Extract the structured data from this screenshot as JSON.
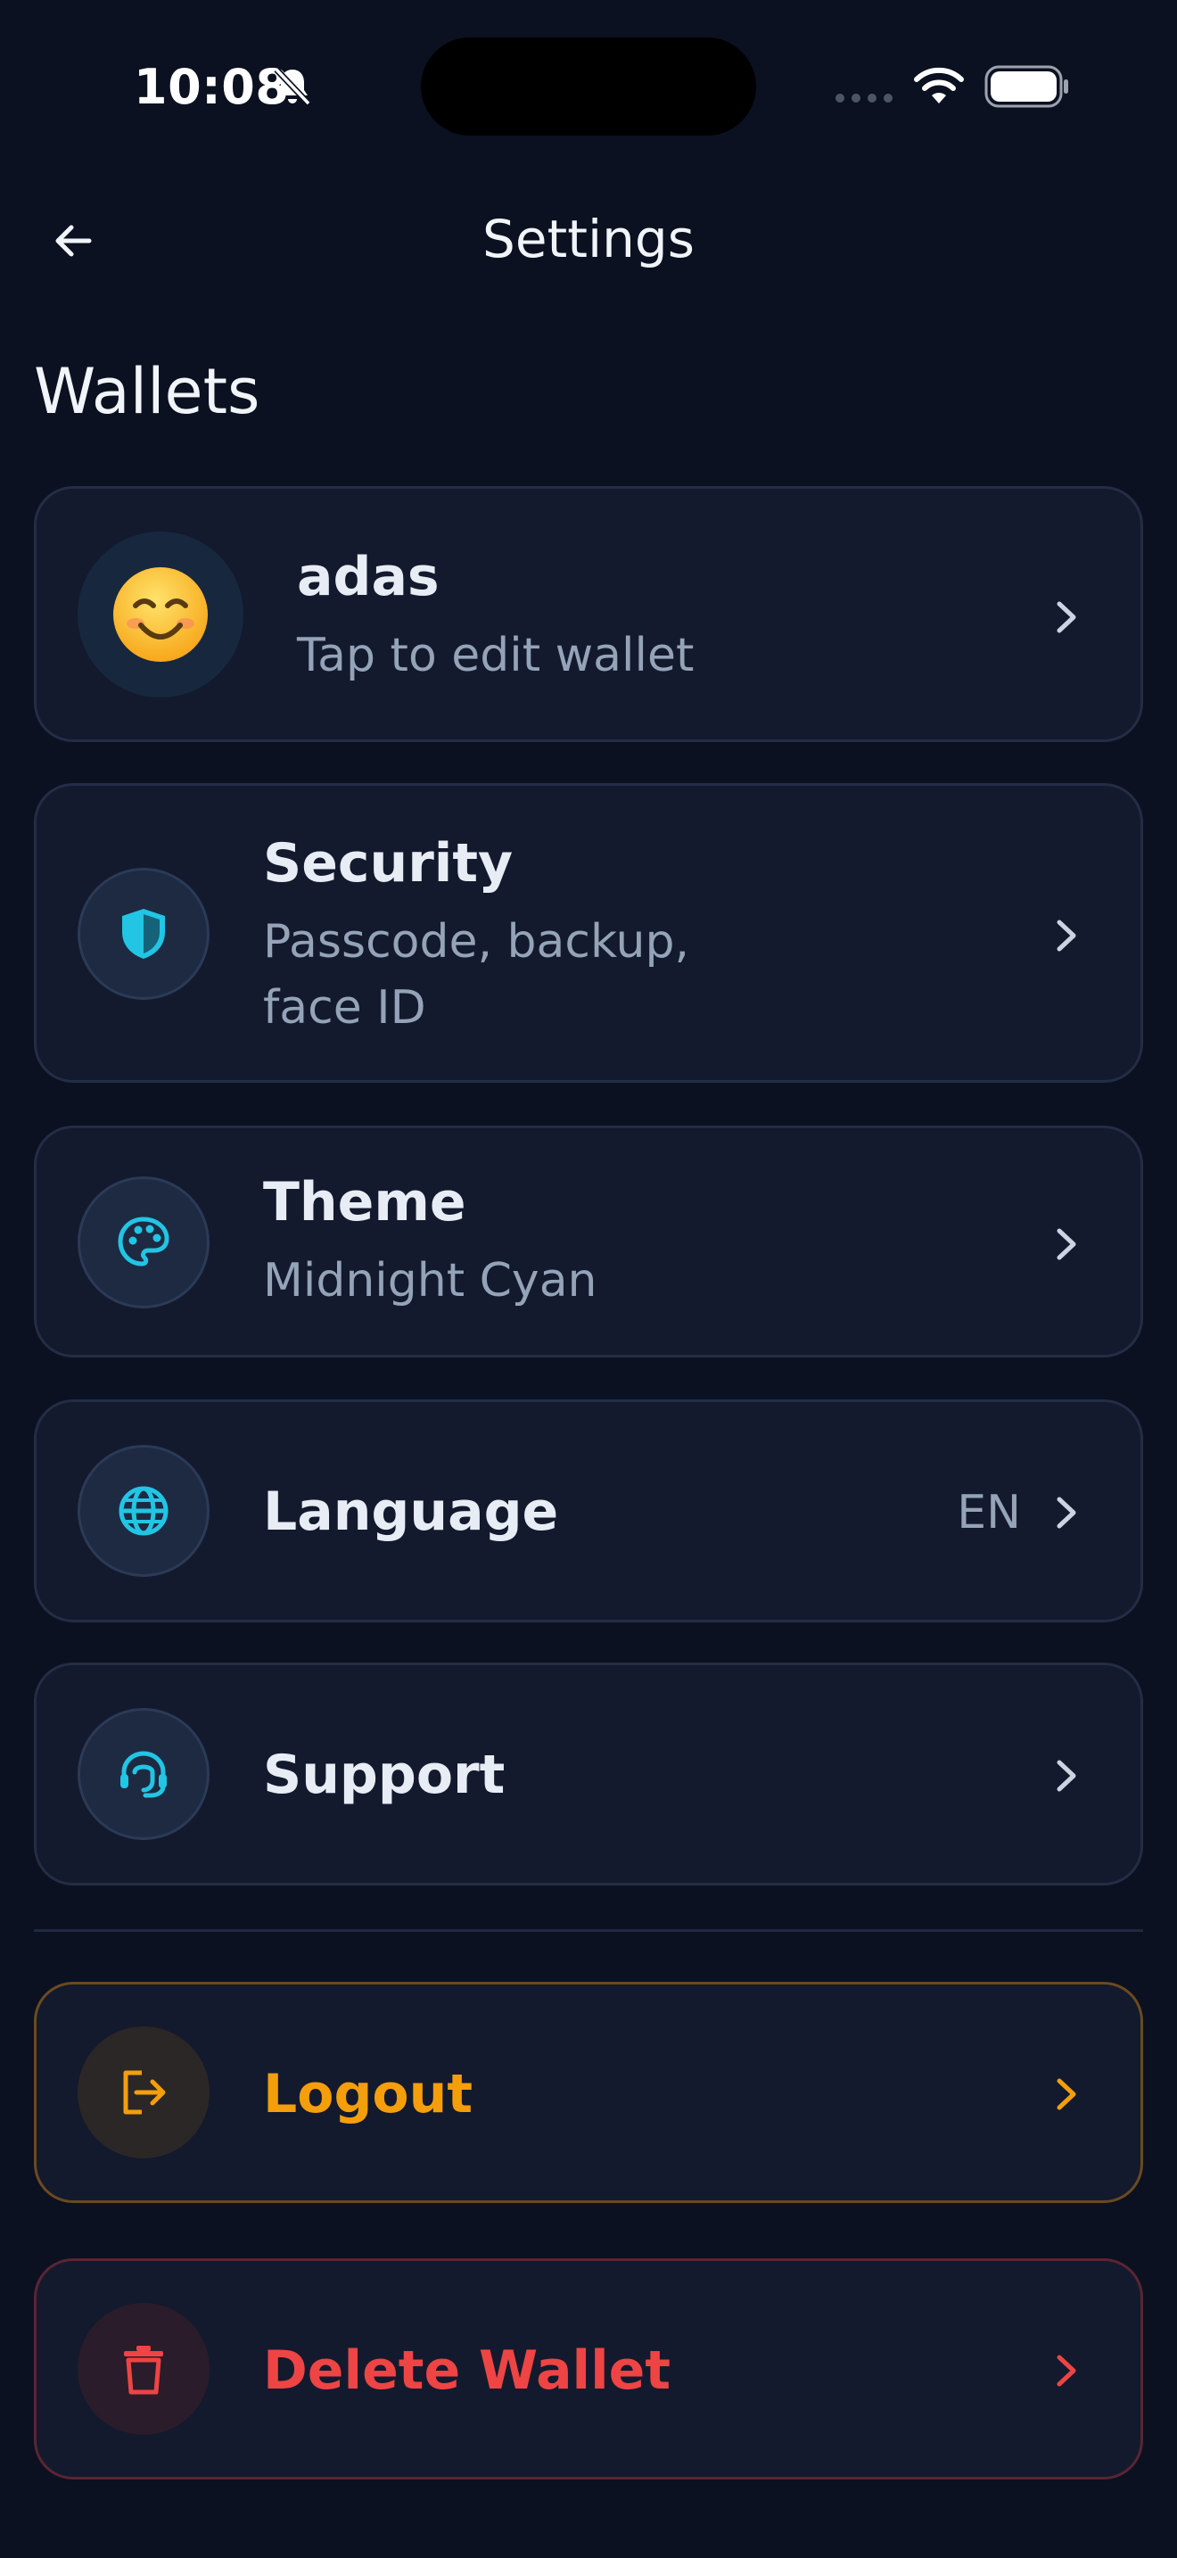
{
  "status_bar": {
    "time": "10:08"
  },
  "header": {
    "title": "Settings"
  },
  "section": {
    "title": "Wallets"
  },
  "wallet": {
    "name": "adas",
    "subtitle": "Tap to edit wallet",
    "emoji": "smiling-face-icon"
  },
  "items": [
    {
      "title": "Security",
      "subtitle_line1": "Passcode, backup,",
      "subtitle_line2": "face ID",
      "icon": "shield-icon"
    },
    {
      "title": "Theme",
      "subtitle": "Midnight Cyan",
      "icon": "palette-icon"
    },
    {
      "title": "Language",
      "trailing": "EN",
      "icon": "globe-icon"
    },
    {
      "title": "Support",
      "icon": "headset-icon"
    }
  ],
  "logout": {
    "title": "Logout",
    "icon": "logout-icon"
  },
  "delete_wallet": {
    "title": "Delete Wallet",
    "icon": "trash-icon"
  },
  "colors": {
    "background": "#0b1120",
    "card": "#131a2e",
    "accent_cyan": "#22c5e4",
    "logout_orange": "#f59e0b",
    "delete_red": "#ef4444"
  }
}
